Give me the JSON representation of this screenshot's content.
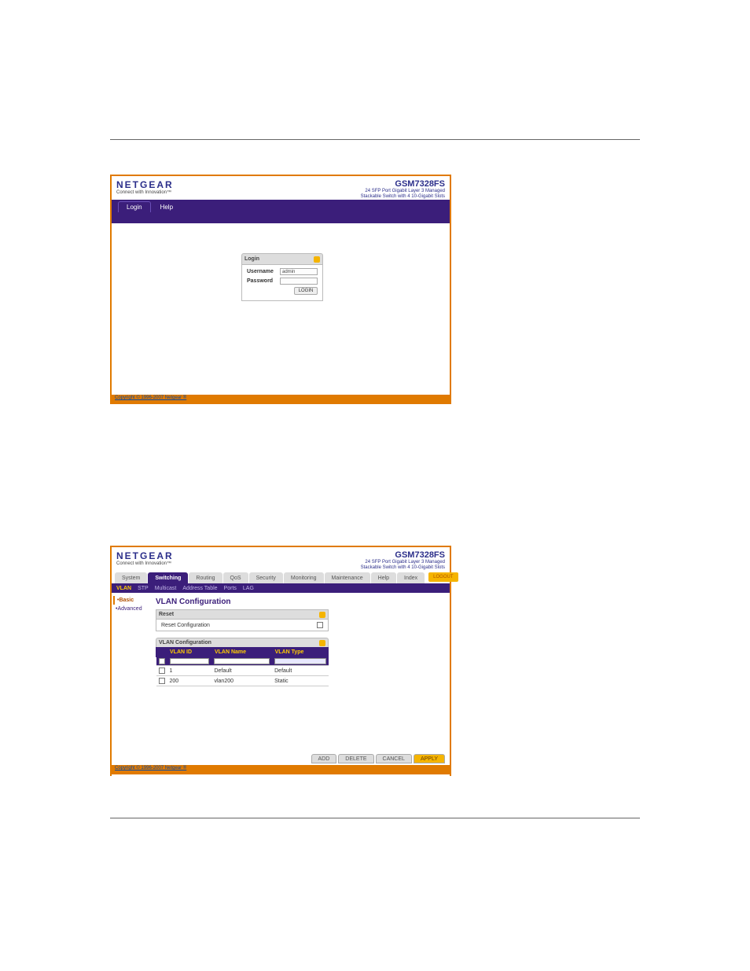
{
  "header_brand": "NETGEAR",
  "header_tagline": "Connect with Innovation™",
  "model": "GSM7328FS",
  "model_desc_1": "24 SFP Port Gigabit Layer 3 Managed",
  "model_desc_2": "Stackable Switch with 4 10-Gigabit Slots",
  "screen1": {
    "tabs": {
      "login": "Login",
      "help": "Help"
    },
    "login_box_title": "Login",
    "username_label": "Username",
    "username_value": "admin",
    "password_label": "Password",
    "login_btn": "LOGIN"
  },
  "copyright": "Copyright © 1996-2007 Netgear ®",
  "screen2": {
    "main_tabs": [
      "System",
      "Switching",
      "Routing",
      "QoS",
      "Security",
      "Monitoring",
      "Maintenance",
      "Help",
      "Index"
    ],
    "logout": "LOGOUT",
    "subtabs": [
      "VLAN",
      "STP",
      "Multicast",
      "Address Table",
      "Ports",
      "LAG"
    ],
    "sidenav": {
      "basic": "•Basic",
      "advanced": "•Advanced"
    },
    "section_title": "VLAN Configuration",
    "reset_panel": {
      "title": "Reset",
      "label": "Reset Configuration"
    },
    "table": {
      "title": "VLAN Configuration",
      "cols": [
        "VLAN ID",
        "VLAN Name",
        "VLAN Type"
      ],
      "rows": [
        {
          "id": "1",
          "name": "Default",
          "type": "Default"
        },
        {
          "id": "200",
          "name": "vlan200",
          "type": "Static"
        }
      ]
    },
    "actions": [
      "ADD",
      "DELETE",
      "CANCEL",
      "APPLY"
    ]
  }
}
